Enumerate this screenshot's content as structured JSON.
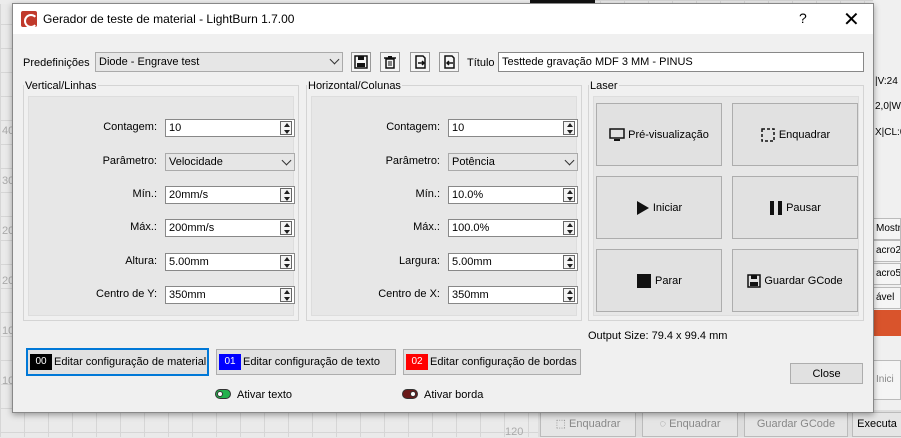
{
  "dialog": {
    "title": "Gerador de teste de material - LightBurn 1.7.00",
    "help_label": "?",
    "close_label": "✕"
  },
  "presets": {
    "label": "Predefinições",
    "value": "Diode - Engrave test",
    "title_label": "Título",
    "title_value": "Testtede gravação MDF 3 MM - PINUS"
  },
  "vertical": {
    "group_title": "Vertical/Linhas",
    "count_label": "Contagem:",
    "count_value": "10",
    "param_label": "Parâmetro:",
    "param_value": "Velocidade",
    "min_label": "Mín.:",
    "min_value": "20mm/s",
    "max_label": "Máx.:",
    "max_value": "200mm/s",
    "size_label": "Altura:",
    "size_value": "5.00mm",
    "center_label": "Centro de Y:",
    "center_value": "350mm"
  },
  "horizontal": {
    "group_title": "Horizontal/Colunas",
    "count_label": "Contagem:",
    "count_value": "10",
    "param_label": "Parâmetro:",
    "param_value": "Potência",
    "min_label": "Mín.:",
    "min_value": "10.0%",
    "max_label": "Máx.:",
    "max_value": "100.0%",
    "size_label": "Largura:",
    "size_value": "5.00mm",
    "center_label": "Centro de X:",
    "center_value": "350mm"
  },
  "laser": {
    "group_title": "Laser",
    "preview_label": "Pré-visualização",
    "frame_label": "Enquadrar",
    "start_label": "Iniciar",
    "pause_label": "Pausar",
    "stop_label": "Parar",
    "save_gcode_label": "Guardar GCode",
    "output_size": "Output Size: 79.4 x 99.4 mm"
  },
  "config": {
    "material_num": "00",
    "material_label": "Editar configuração de material",
    "material_color": "#000000",
    "text_num": "01",
    "text_label": "Editar configuração de texto",
    "text_color": "#0000ff",
    "border_num": "02",
    "border_label": "Editar configuração de bordas",
    "border_color": "#ff0000",
    "enable_text_label": "Ativar texto",
    "enable_text_color": "#22b14c",
    "enable_border_label": "Ativar borda",
    "enable_border_color": "#6b1a1a",
    "close_label": "Close"
  },
  "background": {
    "right_texts": [
      "|V:24",
      "2,0|W",
      "X|CL:0"
    ],
    "right_buttons": [
      "Mostra",
      "acro2",
      "acro5",
      "ável"
    ],
    "start_label": "Inici",
    "bottom_buttons": [
      "Enquadrar",
      "Enquadrar",
      "Guardar GCode",
      "Executa"
    ],
    "ruler_labels": [
      "40",
      "30",
      "30",
      "20",
      "20",
      "10",
      "10",
      "120"
    ]
  }
}
